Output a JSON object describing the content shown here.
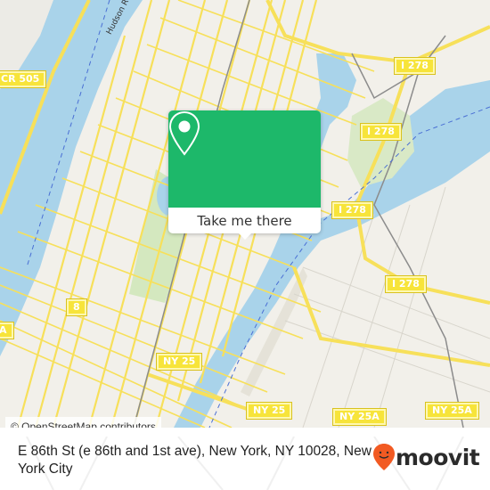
{
  "map": {
    "attribution": "© OpenStreetMap contributors",
    "river_label": "Hudson R",
    "shields": [
      {
        "id": "cr505",
        "label": "CR 505"
      },
      {
        "id": "i278-a",
        "label": "I 278"
      },
      {
        "id": "i278-b",
        "label": "I 278"
      },
      {
        "id": "i278-c",
        "label": "I 278"
      },
      {
        "id": "i278-d",
        "label": "I 278"
      },
      {
        "id": "rt8",
        "label": "8"
      },
      {
        "id": "a-edge",
        "label": "A"
      },
      {
        "id": "ny25-a",
        "label": "NY 25"
      },
      {
        "id": "ny25-b",
        "label": "NY 25"
      },
      {
        "id": "ny25a-a",
        "label": "NY 25A"
      },
      {
        "id": "ny25a-b",
        "label": "NY 25A"
      }
    ],
    "colors": {
      "water": "#a9d3ea",
      "land": "#f2f0ea",
      "park": "#d4e8bf",
      "road": "#f7e05a",
      "rail": "#8c8c8c"
    }
  },
  "popup": {
    "icon": "location-pin-icon",
    "button_label": "Take me there",
    "color": "#1db86a"
  },
  "footer": {
    "address": "E 86th St (e 86th and 1st ave), New York, NY 10028, New York City",
    "brand": "moovit",
    "brand_color": "#f25a22"
  }
}
